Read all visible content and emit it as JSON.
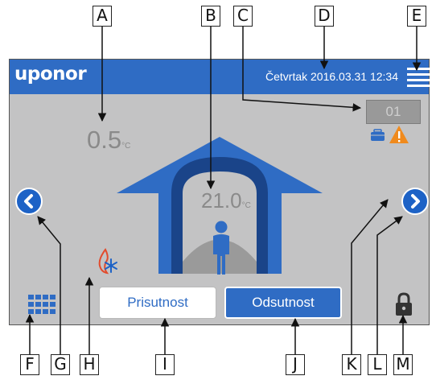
{
  "callouts": [
    "A",
    "B",
    "C",
    "D",
    "E",
    "F",
    "G",
    "H",
    "I",
    "J",
    "K",
    "L",
    "M"
  ],
  "header": {
    "brand": "uponor",
    "datetime": "Četvrtak 2016.03.31 12:34",
    "menu_icon": "hamburger-menu-icon"
  },
  "temperatures": {
    "outdoor_value": "0.5",
    "indoor_value": "21.0",
    "unit": "°C"
  },
  "zone": {
    "number": "01",
    "icons": [
      "suitcase-icon",
      "warning-icon"
    ]
  },
  "icons": {
    "left_nav": "chevron-left-icon",
    "right_nav": "chevron-right-icon",
    "heat_cool": "flame-snowflake-icon",
    "menu_grid": "grid-icon",
    "lock": "lock-icon",
    "house": "house-icon",
    "person": "person-icon"
  },
  "buttons": {
    "presence": "Prisutnost",
    "absence": "Odsutnost"
  },
  "colors": {
    "brand_blue": "#2f6cc4",
    "background_gray": "#c3c3c4",
    "warning_orange": "#f08a1d"
  }
}
